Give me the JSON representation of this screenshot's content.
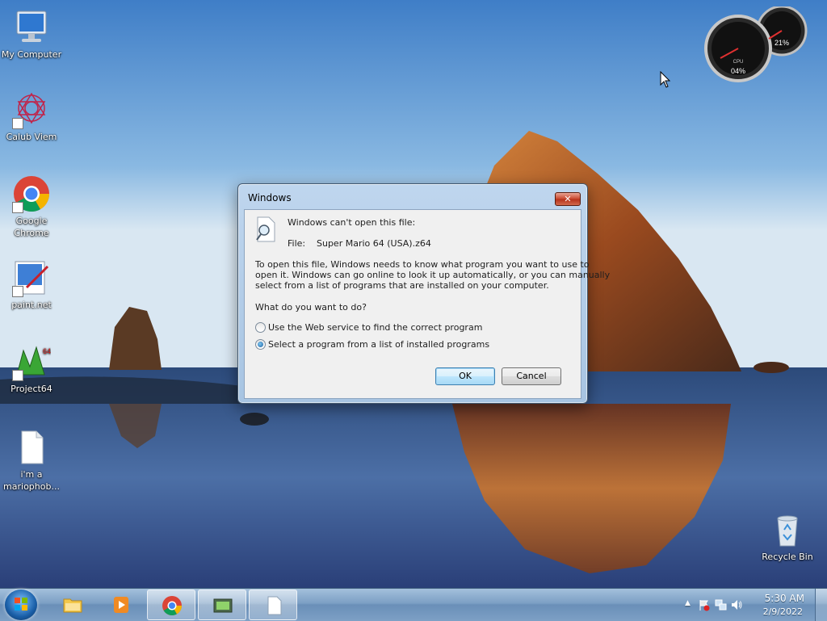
{
  "desktop": {
    "icons": [
      {
        "label": "My Computer"
      },
      {
        "label": "Calub Viem"
      },
      {
        "label": "Google Chrome"
      },
      {
        "label": "paint.net"
      },
      {
        "label": "Project64"
      },
      {
        "label": "i'm a mariophob..."
      },
      {
        "label": "Recycle Bin"
      }
    ],
    "gadget": {
      "cpu_label": "CPU",
      "cpu_value": "04%",
      "ram_value": "21%"
    }
  },
  "dialog": {
    "title": "Windows",
    "close_label": "✕",
    "heading": "Windows can't open this file:",
    "file_label": "File:",
    "file_name": "Super Mario 64 (USA).z64",
    "description_line1": "To open this file, Windows needs to know what program you want to use to",
    "description_line2": "open it. Windows can go online to look it up automatically, or you can manually",
    "description_line3": "select from a list of programs that are installed on your computer.",
    "question": "What do you want to do?",
    "options": [
      {
        "label": "Use the Web service to find the correct program",
        "selected": false
      },
      {
        "label": "Select a program from a list of installed programs",
        "selected": true
      }
    ],
    "ok_label": "OK",
    "cancel_label": "Cancel"
  },
  "taskbar": {
    "clock_time": "5:30 AM",
    "clock_date": "2/9/2022",
    "tray_arrow": "▲"
  }
}
